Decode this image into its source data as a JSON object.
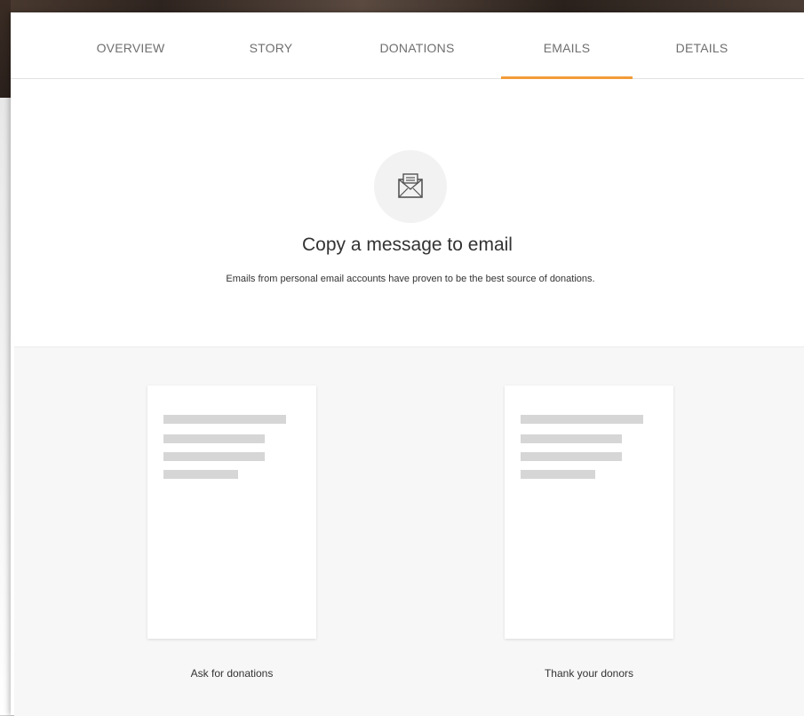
{
  "tabs": [
    {
      "label": "OVERVIEW",
      "active": false
    },
    {
      "label": "STORY",
      "active": false
    },
    {
      "label": "DONATIONS",
      "active": false
    },
    {
      "label": "EMAILS",
      "active": true
    },
    {
      "label": "DETAILS",
      "active": false
    }
  ],
  "hero": {
    "icon": "envelope-icon",
    "title": "Copy a message to email",
    "subtitle": "Emails from personal email accounts have proven to be the best source of donations."
  },
  "templates": [
    {
      "label": "Ask for donations"
    },
    {
      "label": "Thank your donors"
    }
  ],
  "colors": {
    "accent": "#f29c37",
    "tab_text": "#6f6f6f",
    "gallery_bg": "#f7f7f7",
    "placeholder_line": "#d6d6d6"
  }
}
